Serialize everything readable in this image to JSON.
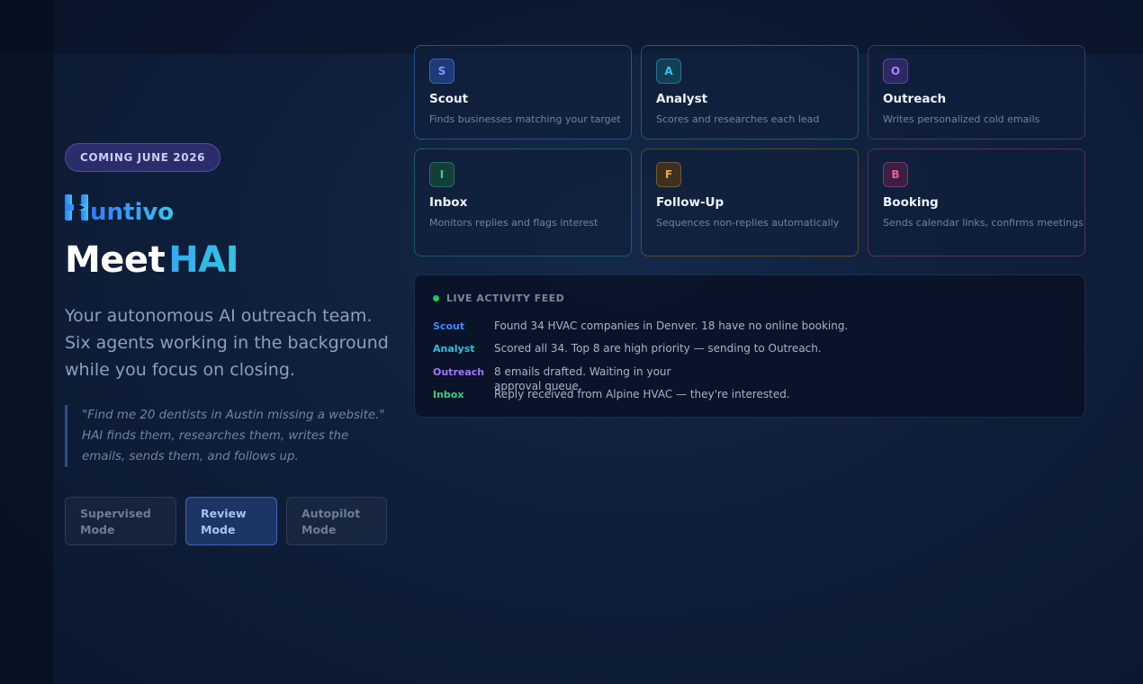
{
  "hero": {
    "badge": "COMING JUNE 2026",
    "logo_text": "Huntivo",
    "headline_meet": "Meet",
    "headline_hai": "HAI",
    "tagline": "Your autonomous AI outreach team. Six agents working in the background while you focus on closing.",
    "quote": "\"Find me 20 dentists in Austin missing a website.\" HAI finds them, researches them, writes the emails, sends them, and follows up.",
    "modes": [
      {
        "label": "Supervised Mode",
        "active": false
      },
      {
        "label": "Review Mode",
        "active": true
      },
      {
        "label": "Autopilot Mode",
        "active": false
      }
    ]
  },
  "agents": [
    {
      "key": "scout",
      "letter": "S",
      "title": "Scout",
      "desc": "Finds businesses matching your target",
      "color": "#6fa0ff"
    },
    {
      "key": "analyst",
      "letter": "A",
      "title": "Analyst",
      "desc": "Scores and researches each lead",
      "color": "#35c5e6"
    },
    {
      "key": "outreach",
      "letter": "O",
      "title": "Outreach",
      "desc": "Writes personalized cold emails",
      "color": "#a987ff"
    },
    {
      "key": "inbox",
      "letter": "I",
      "title": "Inbox",
      "desc": "Monitors replies and flags interest",
      "color": "#35d18e"
    },
    {
      "key": "followup",
      "letter": "F",
      "title": "Follow-Up",
      "desc": "Sequences non-replies automatically",
      "color": "#f0a63a"
    },
    {
      "key": "booking",
      "letter": "B",
      "title": "Booking",
      "desc": "Sends calendar links, confirms meetings",
      "color": "#ee5ca3"
    }
  ],
  "feed": {
    "title": "LIVE ACTIVITY FEED",
    "status_color": "#22c55e",
    "rows": [
      {
        "agent": "Scout",
        "message": "Found 34 HVAC companies in Denver. 18 have no online booking."
      },
      {
        "agent": "Analyst",
        "message": "Scored all 34. Top 8 are high priority — sending to Outreach."
      },
      {
        "agent": "Outreach",
        "message": "8 emails drafted. Waiting in your approval queue."
      },
      {
        "agent": "Inbox",
        "message": "Reply received from Alpine HVAC — they're interested."
      }
    ]
  }
}
